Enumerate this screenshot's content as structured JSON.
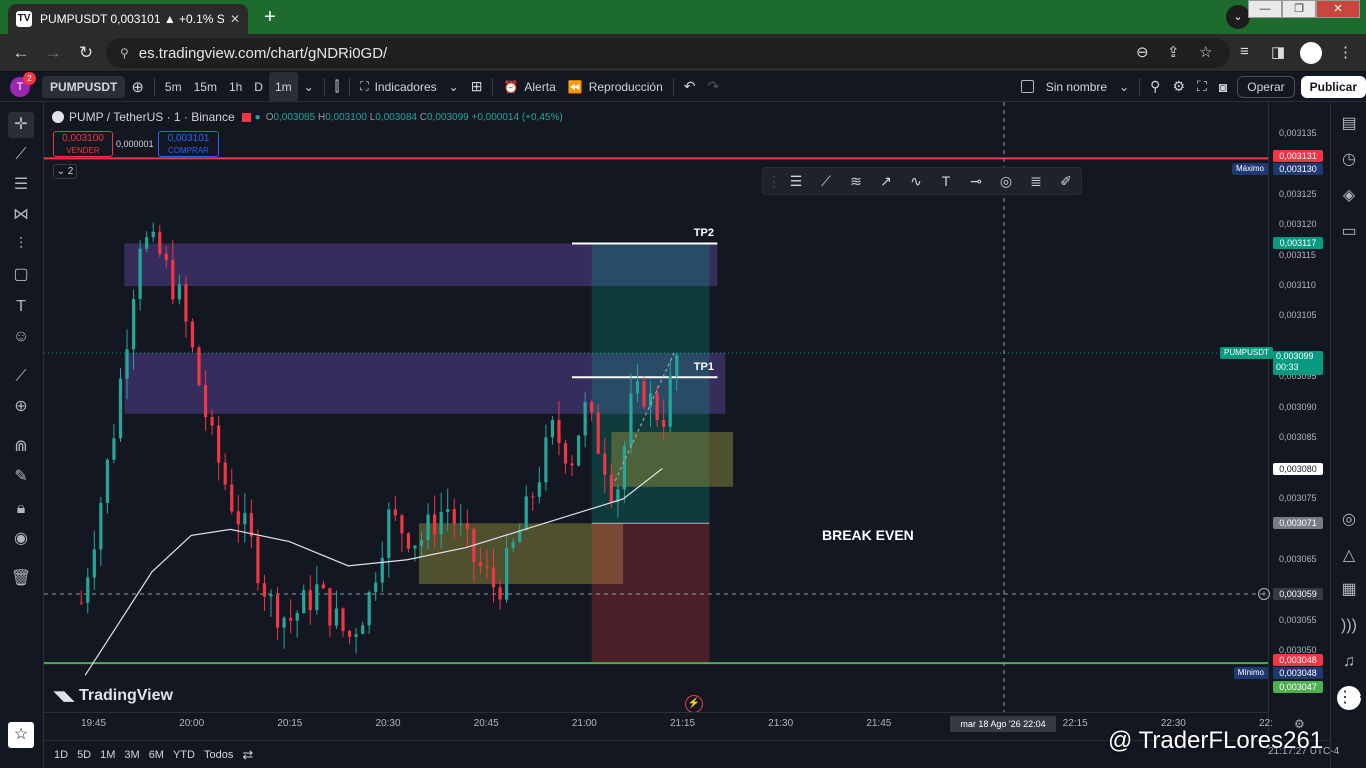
{
  "browser": {
    "tab_title": "PUMPUSDT 0,003101 ▲ +0.1% S",
    "tab_close": "✕",
    "new_tab": "+",
    "url": "es.tradingview.com/chart/gNDRi0GD/",
    "window_controls": [
      "—",
      "❐",
      "✕"
    ]
  },
  "toolbar": {
    "avatar": "T",
    "notifications": "2",
    "symbol": "PUMPUSDT",
    "timeframes": [
      "5m",
      "15m",
      "1h",
      "D",
      "1m"
    ],
    "active_timeframe": "1m",
    "indicators": "Indicadores",
    "alert": "Alerta",
    "replay": "Reproducción",
    "layout_name": "Sin nombre",
    "trade": "Operar",
    "publish": "Publicar"
  },
  "legend": {
    "title": "PUMP / TetherUS · 1 · Binance",
    "o_label": "O",
    "o": "0,003085",
    "h_label": "H",
    "h": "0,003100",
    "l_label": "L",
    "l": "0,003084",
    "c_label": "C",
    "c": "0,003099",
    "change": "+0,000014 (+0,45%)",
    "sell_price": "0,003100",
    "sell_label": "VENDER",
    "spread": "0,000001",
    "buy_price": "0,003101",
    "buy_label": "COMPRAR",
    "collapse": "⌄ 2"
  },
  "price_axis": {
    "labels": [
      {
        "v": "0,003135",
        "p": 0.003135
      },
      {
        "v": "0,003125",
        "p": 0.003125
      },
      {
        "v": "0,003120",
        "p": 0.00312
      },
      {
        "v": "0,003115",
        "p": 0.003115
      },
      {
        "v": "0,003110",
        "p": 0.00311
      },
      {
        "v": "0,003105",
        "p": 0.003105
      },
      {
        "v": "0,003095",
        "p": 0.003095
      },
      {
        "v": "0,003090",
        "p": 0.00309
      },
      {
        "v": "0,003085",
        "p": 0.003085
      },
      {
        "v": "0,003075",
        "p": 0.003075
      },
      {
        "v": "0,003065",
        "p": 0.003065
      },
      {
        "v": "0,003055",
        "p": 0.003055
      },
      {
        "v": "0,003050",
        "p": 0.00305
      }
    ],
    "max_tag": "0,003131",
    "max_tag2": "0,003130",
    "max_label": "Máximo",
    "tp2_tag": "0,003117",
    "current_symbol": "PUMPUSDT",
    "current": "0,003099",
    "countdown": "00:33",
    "tag_3080": "0,003080",
    "tag_3071": "0,003071",
    "cross_price": "0,003059",
    "min_tag": "0,003048",
    "min_tag2": "0,003048",
    "min_label": "Mínimo",
    "low_tag": "0,003047"
  },
  "time_axis": {
    "labels": [
      "19:45",
      "20:00",
      "20:15",
      "20:30",
      "20:45",
      "21:00",
      "21:15",
      "21:30",
      "21:45",
      "22:15",
      "22:30",
      "22:"
    ],
    "cursor_date": "mar 18 Ago '26   22:04"
  },
  "chart_labels": {
    "tp1": "TP1",
    "tp2": "TP2",
    "break_even": "BREAK EVEN"
  },
  "branding": {
    "tv_logo": "TradingView",
    "watermark": "@ TraderFLores261"
  },
  "bottom": {
    "ranges": [
      "1D",
      "5D",
      "1M",
      "3M",
      "6M",
      "YTD",
      "Todos"
    ],
    "clock": "21:17:27 UTC-4"
  },
  "colors": {
    "up": "#26a69a",
    "down": "#f23645",
    "max_line": "#f23645",
    "min_line": "#4caf50",
    "zone_purple": "#7b57c9",
    "zone_olive": "#8c8a3a"
  },
  "chart_data": {
    "type": "candlestick",
    "symbol": "PUMP / TetherUS",
    "interval": "1",
    "ylim": [
      0.003045,
      0.003139
    ],
    "max": 0.003131,
    "min": 0.003048,
    "tp1": 0.003095,
    "tp2": 0.003117,
    "break_even": 0.003071,
    "current": 0.003099,
    "ohlc_last": {
      "o": 0.003085,
      "h": 0.0031,
      "l": 0.003084,
      "c": 0.003099
    },
    "moving_average": [
      [
        19.73,
        0.003046
      ],
      [
        19.9,
        0.003063
      ],
      [
        20.0,
        0.003069
      ],
      [
        20.1,
        0.00307
      ],
      [
        20.25,
        0.003068
      ],
      [
        20.4,
        0.003064
      ],
      [
        20.55,
        0.003065
      ],
      [
        20.7,
        0.003067
      ],
      [
        20.85,
        0.00307
      ],
      [
        21.0,
        0.003073
      ],
      [
        21.1,
        0.003075
      ],
      [
        21.2,
        0.00308
      ]
    ],
    "path_close": [
      [
        19.72,
        0.003058
      ],
      [
        19.8,
        0.003085
      ],
      [
        19.87,
        0.003118
      ],
      [
        19.92,
        0.003115
      ],
      [
        19.97,
        0.003108
      ],
      [
        20.0,
        0.0031
      ],
      [
        20.05,
        0.003085
      ],
      [
        20.1,
        0.003075
      ],
      [
        20.15,
        0.003068
      ],
      [
        20.2,
        0.003058
      ],
      [
        20.25,
        0.003055
      ],
      [
        20.32,
        0.00306
      ],
      [
        20.4,
        0.003052
      ],
      [
        20.45,
        0.003058
      ],
      [
        20.5,
        0.003072
      ],
      [
        20.58,
        0.003068
      ],
      [
        20.65,
        0.003074
      ],
      [
        20.72,
        0.003065
      ],
      [
        20.78,
        0.00306
      ],
      [
        20.85,
        0.003072
      ],
      [
        20.92,
        0.003086
      ],
      [
        20.97,
        0.003082
      ],
      [
        21.0,
        0.00309
      ],
      [
        21.05,
        0.003082
      ],
      [
        21.08,
        0.003075
      ],
      [
        21.12,
        0.00309
      ],
      [
        21.15,
        0.003093
      ],
      [
        21.2,
        0.003088
      ],
      [
        21.24,
        0.003099
      ]
    ]
  }
}
